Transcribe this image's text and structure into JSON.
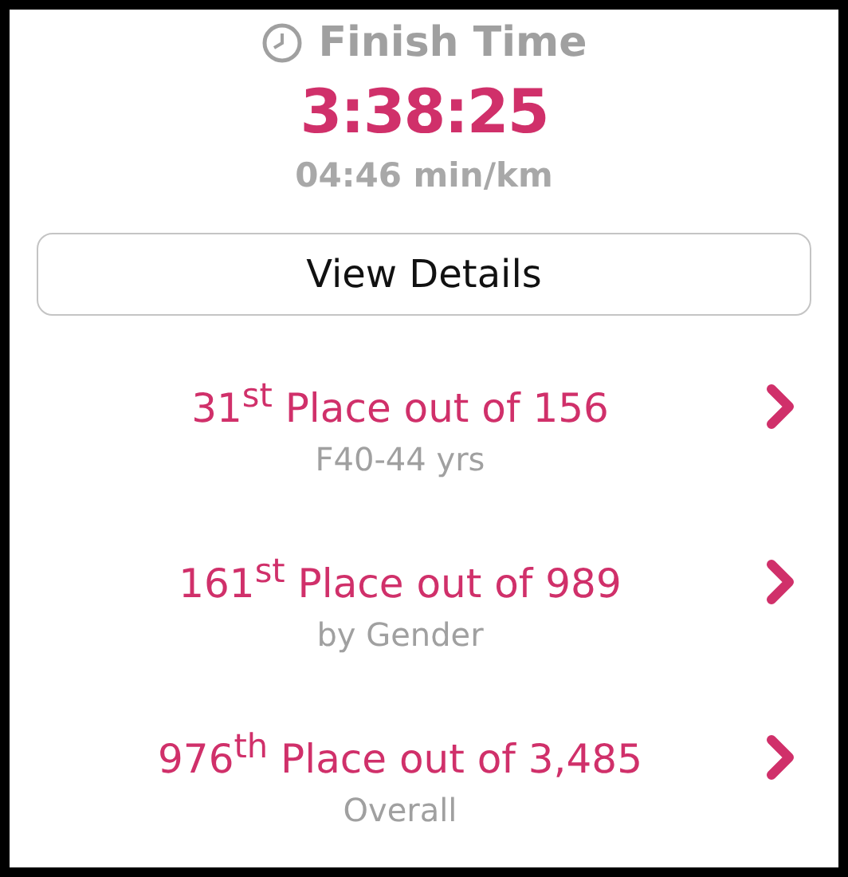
{
  "header": {
    "title": "Finish Time",
    "time": "3:38:25",
    "pace": "04:46 min/km"
  },
  "details_button": {
    "label": "View Details"
  },
  "placings": [
    {
      "place": "31$^{st}$ Place out of 156",
      "category": "F40-44 yrs"
    },
    {
      "place": "161$^{st}$ Place out of 989",
      "category": "by Gender"
    },
    {
      "place": "976$^{th}$ Place out of 3,485",
      "category": "Overall"
    }
  ]
}
